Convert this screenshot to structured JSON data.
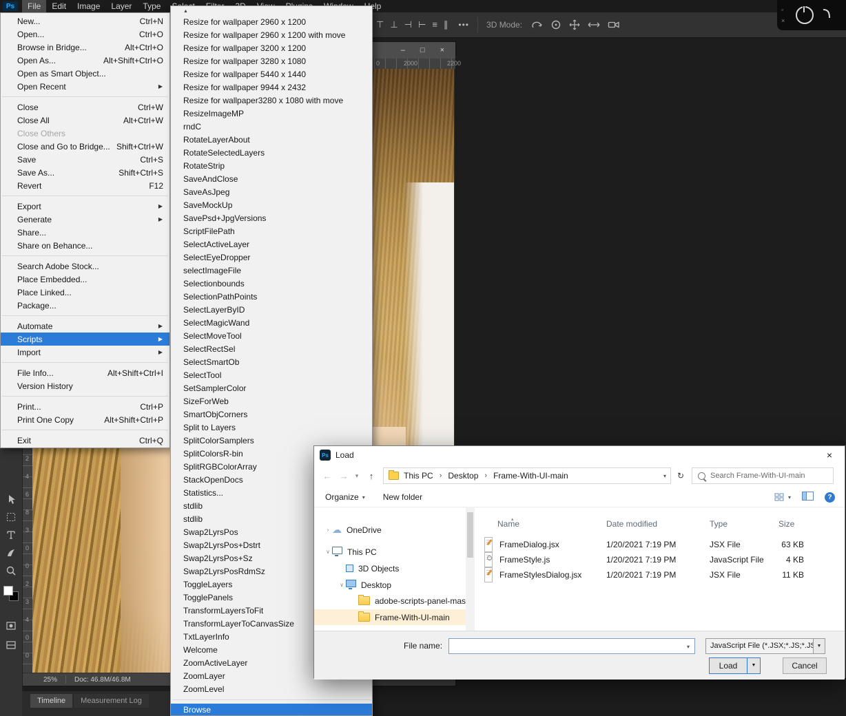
{
  "menubar": {
    "logo": "Ps",
    "active": "File",
    "items": [
      "File",
      "Edit",
      "Image",
      "Layer",
      "Type",
      "Select",
      "Filter",
      "3D",
      "View",
      "Plugins",
      "Window",
      "Help"
    ]
  },
  "options_bar": {
    "align_icons": [
      "⊤",
      "⊥",
      "⊣",
      "⊢",
      "≡",
      "∥"
    ],
    "more": "•••",
    "mode_label": "3D Mode:"
  },
  "overlay": {
    "icons": [
      "▫",
      "×"
    ]
  },
  "icons": {
    "close": "×",
    "minimize": "–",
    "maximize": "□",
    "submenu_arrow": "▶",
    "scroll_up": "▲",
    "dropdown": "▾",
    "split_down": "▼",
    "back": "←",
    "forward": "→",
    "up": "↑",
    "refresh": "↻",
    "breadcrumb_sep": "›",
    "sort": "▴",
    "tree_expanded": "∨",
    "tree_collapsed": "›",
    "help": "?"
  },
  "file_menu": {
    "items": [
      {
        "label": "New...",
        "shortcut": "Ctrl+N"
      },
      {
        "label": "Open...",
        "shortcut": "Ctrl+O"
      },
      {
        "label": "Browse in Bridge...",
        "shortcut": "Alt+Ctrl+O"
      },
      {
        "label": "Open As...",
        "shortcut": "Alt+Shift+Ctrl+O"
      },
      {
        "label": "Open as Smart Object..."
      },
      {
        "label": "Open Recent",
        "submenu": true
      },
      {
        "separator": true
      },
      {
        "label": "Close",
        "shortcut": "Ctrl+W"
      },
      {
        "label": "Close All",
        "shortcut": "Alt+Ctrl+W"
      },
      {
        "label": "Close Others",
        "disabled": true
      },
      {
        "label": "Close and Go to Bridge...",
        "shortcut": "Shift+Ctrl+W"
      },
      {
        "label": "Save",
        "shortcut": "Ctrl+S"
      },
      {
        "label": "Save As...",
        "shortcut": "Shift+Ctrl+S"
      },
      {
        "label": "Revert",
        "shortcut": "F12"
      },
      {
        "separator": true
      },
      {
        "label": "Export",
        "submenu": true
      },
      {
        "label": "Generate",
        "submenu": true
      },
      {
        "label": "Share..."
      },
      {
        "label": "Share on Behance..."
      },
      {
        "separator": true
      },
      {
        "label": "Search Adobe Stock..."
      },
      {
        "label": "Place Embedded..."
      },
      {
        "label": "Place Linked..."
      },
      {
        "label": "Package..."
      },
      {
        "separator": true
      },
      {
        "label": "Automate",
        "submenu": true
      },
      {
        "label": "Scripts",
        "submenu": true,
        "highlighted": true
      },
      {
        "label": "Import",
        "submenu": true
      },
      {
        "separator": true
      },
      {
        "label": "File Info...",
        "shortcut": "Alt+Shift+Ctrl+I"
      },
      {
        "label": "Version History"
      },
      {
        "separator": true
      },
      {
        "label": "Print...",
        "shortcut": "Ctrl+P"
      },
      {
        "label": "Print One Copy",
        "shortcut": "Alt+Shift+Ctrl+P"
      },
      {
        "separator": true
      },
      {
        "label": "Exit",
        "shortcut": "Ctrl+Q"
      }
    ]
  },
  "scripts_submenu": {
    "scroll_up": "▲",
    "items": [
      "Resize for wallpaper 2960 x 1200",
      "Resize for wallpaper 2960 x 1200 with move",
      "Resize for wallpaper 3200 x 1200",
      "Resize for wallpaper 3280 x 1080",
      "Resize for wallpaper 5440 x 1440",
      "Resize for wallpaper 9944 x 2432",
      "Resize for wallpaper3280 x 1080 with move",
      "ResizeImageMP",
      "rndC",
      "RotateLayerAbout",
      "RotateSelectedLayers",
      "RotateStrip",
      "SaveAndClose",
      "SaveAsJpeg",
      "SaveMockUp",
      "SavePsd+JpgVersions",
      "ScriptFilePath",
      "SelectActiveLayer",
      "SelectEyeDropper",
      "selectImageFile",
      "Selectionbounds",
      "SelectionPathPoints",
      "SelectLayerByID",
      "SelectMagicWand",
      "SelectMoveTool",
      "SelectRectSel",
      "SelectSmartOb",
      "SelectTool",
      "SetSamplerColor",
      "SizeForWeb",
      "SmartObjCorners",
      "Split to Layers",
      "SplitColorSamplers",
      "SplitColorsR-bin",
      "SplitRGBColorArray",
      "StackOpenDocs",
      "Statistics...",
      "stdlib",
      "stdlib",
      "Swap2LyrsPos",
      "Swap2LyrsPos+Dstrt",
      "Swap2LyrsPos+Sz",
      "Swap2LyrsPosRdmSz",
      "ToggleLayers",
      "TogglePanels",
      "TransformLayersToFit",
      "TransformLayerToCanvasSize",
      "TxtLayerInfo",
      "Welcome",
      "ZoomActiveLayer",
      "ZoomLayer",
      "ZoomLevel"
    ],
    "footer_item": "Browse"
  },
  "document": {
    "ruler_h": [
      "0",
      "2000",
      "2200"
    ],
    "ruler_v": [
      "2",
      "4",
      "6",
      "8",
      "3",
      "0",
      "0",
      "2",
      "3",
      "4",
      "0",
      "0"
    ],
    "zoom": "25%",
    "doc_info": "Doc: 46.8M/46.8M"
  },
  "panels": {
    "tabs": [
      "Timeline",
      "Measurement Log"
    ]
  },
  "tools": [
    "move",
    "marquee",
    "type",
    "brush",
    "zoom",
    "foreground-background-swatches",
    "mask",
    "screen-mode"
  ],
  "load_dialog": {
    "title": "Load",
    "breadcrumb": [
      "This PC",
      "Desktop",
      "Frame-With-UI-main"
    ],
    "search_placeholder": "Search Frame-With-UI-main",
    "toolbar": {
      "organize": "Organize",
      "new_folder": "New folder"
    },
    "columns": [
      "Name",
      "Date modified",
      "Type",
      "Size"
    ],
    "nav": [
      {
        "label": "OneDrive",
        "icon": "cloud",
        "chevron": "collapsed"
      },
      {
        "label": "This PC",
        "icon": "pc",
        "chevron": "expanded"
      },
      {
        "label": "3D Objects",
        "icon": "cube"
      },
      {
        "label": "Desktop",
        "icon": "desktop",
        "chevron": "expanded"
      },
      {
        "label": "adobe-scripts-panel-master",
        "icon": "folder"
      },
      {
        "label": "Frame-With-UI-main",
        "icon": "folder",
        "selected": true
      }
    ],
    "files": [
      {
        "name": "FrameDialog.jsx",
        "modified": "1/20/2021 7:19 PM",
        "type": "JSX File",
        "size": "63 KB"
      },
      {
        "name": "FrameStyle.js",
        "modified": "1/20/2021 7:19 PM",
        "type": "JavaScript File",
        "size": "4 KB"
      },
      {
        "name": "FrameStylesDialog.jsx",
        "modified": "1/20/2021 7:19 PM",
        "type": "JSX File",
        "size": "11 KB"
      }
    ],
    "file_name_label": "File name:",
    "file_name_value": "",
    "file_type": "JavaScript File (*.JSX;*.JS;*.JSXBI",
    "load_button": "Load",
    "cancel_button": "Cancel"
  },
  "colors": {
    "accent": "#2b7cd9",
    "nav_selection": "#fdf0d6",
    "folder": "#ffd04c",
    "dark_bg": "#1d1d1d"
  }
}
